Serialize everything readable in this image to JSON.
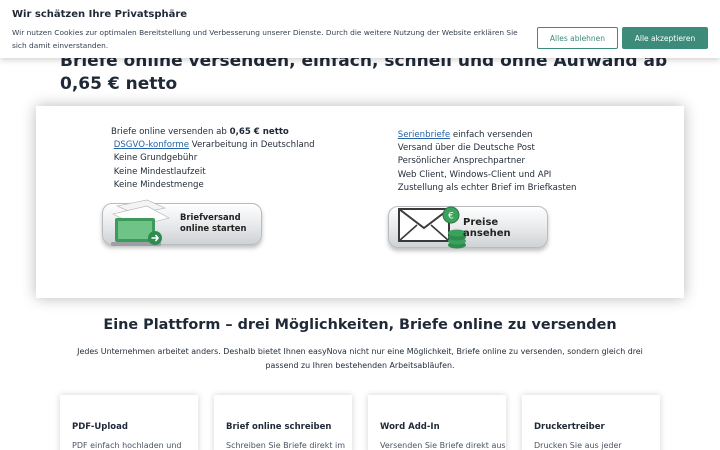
{
  "cookie": {
    "title": "Wir schätzen Ihre Privatsphäre",
    "text": "Wir nutzen Cookies zur optimalen Bereitstellung und Verbesserung unserer Dienste. Durch die weitere Nutzung der Website erklären Sie sich damit einverstanden.",
    "decline_label": "Alles ablehnen",
    "accept_label": "Alle akzeptieren",
    "accent_color": "#3d8b7a"
  },
  "headline": "Briefe online versenden, einfach, schnell und ohne Aufwand ab 0,65 € netto",
  "features_left": {
    "item1_text": "Briefe online versenden ab ",
    "item1_bold": "0,65 € netto",
    "item2_link": "DSGVO-konforme",
    "item2_text": " Verarbeitung in Deutschland",
    "item3": "Keine Grundgebühr",
    "item4": "Keine Mindestlaufzeit",
    "item5": "Keine Mindestmenge"
  },
  "features_right": {
    "item1_link": "Serienbriefe",
    "item1_text": " einfach versenden",
    "item2": "Versand über die Deutsche Post",
    "item3": "Persönlicher Ansprechpartner",
    "item4": "Web Client, Windows-Client und API",
    "item5": "Zustellung als echter Brief im Briefkasten"
  },
  "glyph": "",
  "cta_start": {
    "line1": "Briefversand",
    "line2": "online starten"
  },
  "cta_prices": {
    "label": "Preise ansehen"
  },
  "section": {
    "title": "Eine Plattform – drei Möglichkeiten, Briefe online zu versenden",
    "text": "Jedes Unternehmen arbeitet anders. Deshalb bietet Ihnen easyNova nicht nur eine Möglichkeit, Briefe online zu versenden, sondern gleich drei passend zu Ihren bestehenden Arbeitsabläufen."
  },
  "tiles": [
    {
      "title": "PDF-Upload",
      "desc": "PDF einfach hochladen und"
    },
    {
      "title": "Brief online schreiben",
      "desc": "Schreiben Sie Briefe direkt im"
    },
    {
      "title": "Word Add-In",
      "desc": "Versenden Sie Briefe direkt aus"
    },
    {
      "title": "Druckertreiber",
      "desc": "Drucken Sie aus jeder"
    }
  ]
}
